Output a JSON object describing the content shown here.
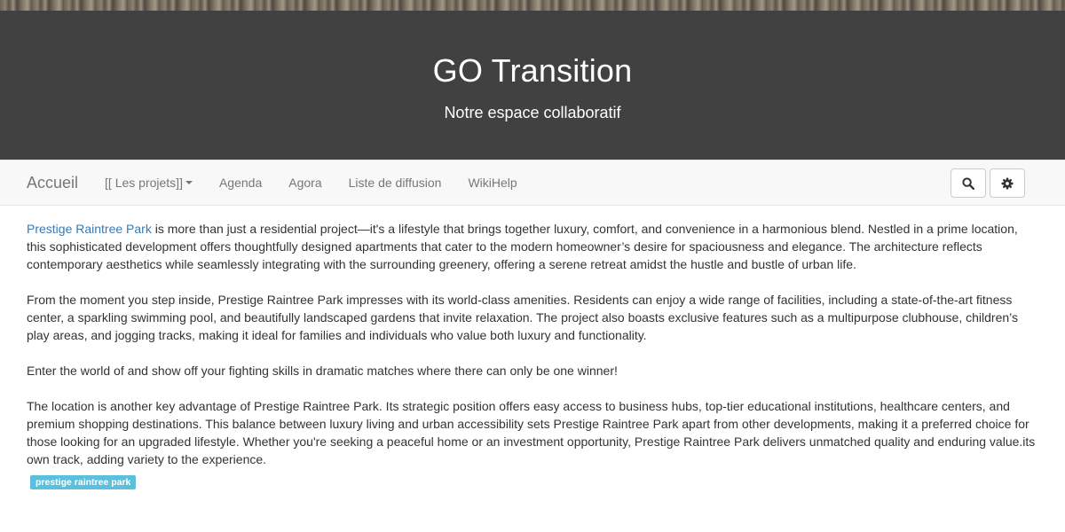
{
  "header": {
    "title": "GO Transition",
    "subtitle": "Notre espace collaboratif"
  },
  "nav": {
    "brand": "Accueil",
    "items": [
      {
        "label": "[[ Les projets]]",
        "dropdown": true
      },
      {
        "label": "Agenda"
      },
      {
        "label": "Agora"
      },
      {
        "label": "Liste de diffusion"
      },
      {
        "label": "WikiHelp"
      }
    ],
    "search_icon": "search-icon",
    "settings_icon": "gear-icon"
  },
  "article": {
    "p1_link": "Prestige Raintree Park",
    "p1_rest": " is more than just a residential project—it's a lifestyle that brings together luxury, comfort, and convenience in a harmonious blend. Nestled in a prime location, this sophisticated development offers thoughtfully designed apartments that cater to the modern homeowner’s desire for spaciousness and elegance. The architecture reflects contemporary aesthetics while seamlessly integrating with the surrounding greenery, offering a serene retreat amidst the hustle and bustle of urban life.",
    "p2": "From the moment you step inside, Prestige Raintree Park impresses with its world-class amenities. Residents can enjoy a wide range of facilities, including a state-of-the-art fitness center, a sparkling swimming pool, and beautifully landscaped gardens that invite relaxation. The project also boasts exclusive features such as a multipurpose clubhouse, children’s play areas, and jogging tracks, making it ideal for families and individuals who value both luxury and functionality.",
    "p3": "Enter the world of and show off your fighting skills in dramatic matches where there can only be one winner!",
    "p4": "The location is another key advantage of Prestige Raintree Park. Its strategic position offers easy access to business hubs, top-tier educational institutions, healthcare centers, and premium shopping destinations. This balance between luxury living and urban accessibility sets Prestige Raintree Park apart from other developments, making it a preferred choice for those looking for an upgraded lifestyle. Whether you're seeking a peaceful home or an investment opportunity, Prestige Raintree Park delivers unmatched quality and enduring value.its own track, adding variety to the experience.",
    "tag": "prestige raintree park"
  },
  "colors": {
    "banner_bg": "#414141",
    "link": "#337ab7",
    "tag_bg": "#5bc0de"
  }
}
